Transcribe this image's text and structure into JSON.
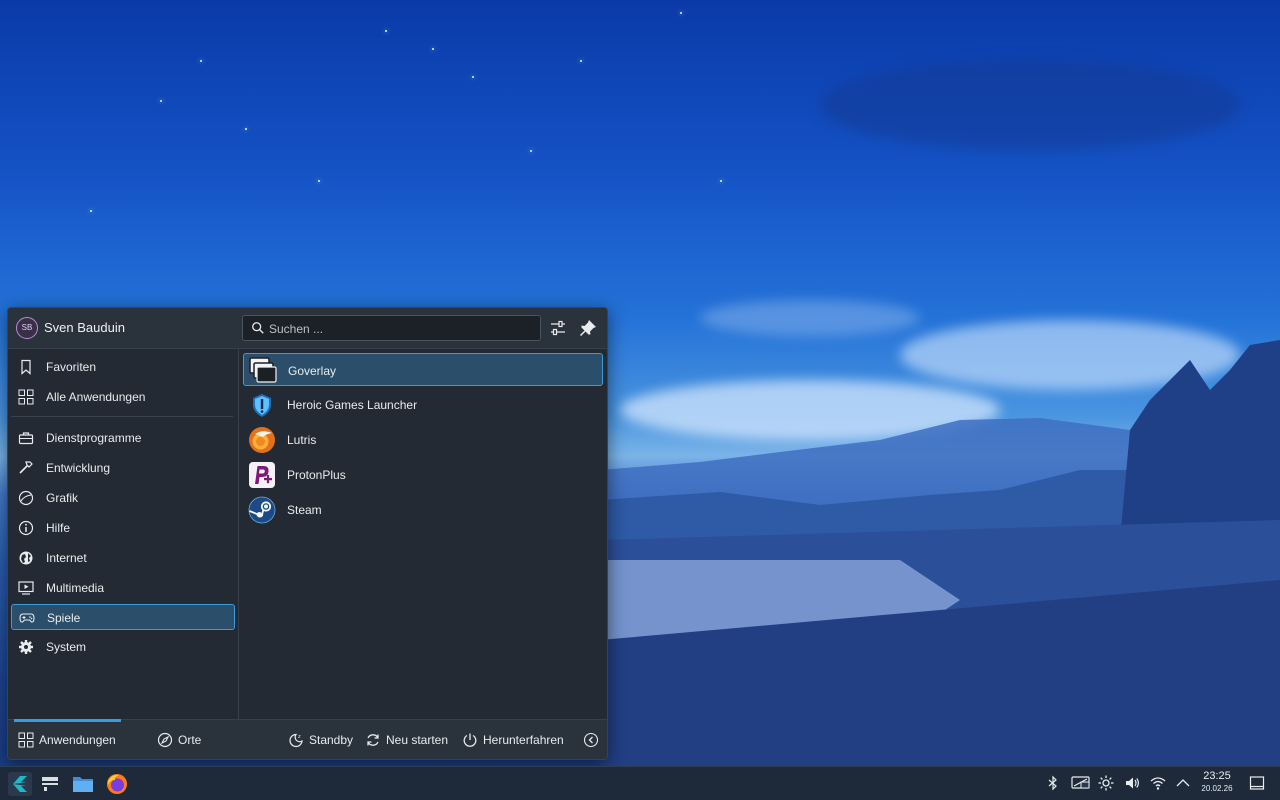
{
  "user": {
    "initials": "SB",
    "name": "Sven Bauduin"
  },
  "search": {
    "placeholder": "Suchen ..."
  },
  "header_icons": [
    "configure-icon",
    "pin-icon"
  ],
  "sidebar": {
    "items": [
      {
        "label": "Favoriten",
        "icon": "bookmark-icon"
      },
      {
        "label": "Alle Anwendungen",
        "icon": "grid-icon"
      },
      {
        "label": "Dienstprogramme",
        "icon": "toolbox-icon"
      },
      {
        "label": "Entwicklung",
        "icon": "hammer-icon"
      },
      {
        "label": "Grafik",
        "icon": "graphics-icon"
      },
      {
        "label": "Hilfe",
        "icon": "info-icon"
      },
      {
        "label": "Internet",
        "icon": "globe-icon"
      },
      {
        "label": "Multimedia",
        "icon": "multimedia-icon"
      },
      {
        "label": "Spiele",
        "icon": "gamepad-icon",
        "selected": true
      },
      {
        "label": "System",
        "icon": "gear-icon"
      }
    ]
  },
  "apps": [
    {
      "label": "Goverlay",
      "icon": "goverlay-icon",
      "selected": true
    },
    {
      "label": "Heroic Games Launcher",
      "icon": "heroic-icon"
    },
    {
      "label": "Lutris",
      "icon": "lutris-icon"
    },
    {
      "label": "ProtonPlus",
      "icon": "protonplus-icon"
    },
    {
      "label": "Steam",
      "icon": "steam-icon"
    }
  ],
  "footer": {
    "tabs": [
      {
        "label": "Anwendungen",
        "active": true
      },
      {
        "label": "Orte"
      }
    ],
    "actions": [
      {
        "label": "Standby"
      },
      {
        "label": "Neu starten"
      },
      {
        "label": "Herunterfahren"
      }
    ]
  },
  "taskbar": {
    "clock": {
      "time": "23:25",
      "date": "20.02.26"
    },
    "tray_icons": [
      "bluetooth-icon",
      "display-icon",
      "brightness-icon",
      "volume-icon",
      "wifi-icon",
      "chevron-up-icon"
    ]
  },
  "colors": {
    "accent": "#3d9ad6",
    "panel": "#232a33",
    "taskbar": "#1e2a3a"
  }
}
